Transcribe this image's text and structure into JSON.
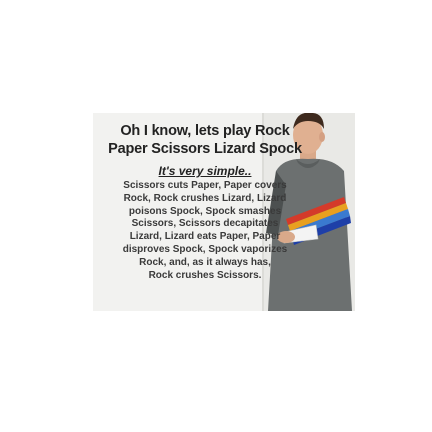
{
  "meme": {
    "heading_lines": [
      "Oh I know, lets play Rock",
      "Paper Scissors Lizard Spock"
    ],
    "tagline": "It's very simple..",
    "body_lines": [
      "Scissors cuts Paper, Paper covers",
      "Rock, Rock crushes Lizard, Lizard",
      "poisons Spock, Spock smashes",
      "Scissors, Scissors decapitates",
      "Lizard, Lizard eats Paper, Paper",
      "disproves Spock, Spock vaporizes",
      "Rock, and, as it always has,",
      "Rock crushes Scissors."
    ]
  },
  "colors": {
    "card_background": "#f2f2f0",
    "text": "#2a2a2a",
    "shirt_gray": "#6c7070",
    "shirt_stripes": [
      "#d43a2a",
      "#e8a020",
      "#3a7ad0",
      "#1e3fa8"
    ]
  },
  "image": {
    "subject": "man-in-striped-shirt-photo"
  }
}
